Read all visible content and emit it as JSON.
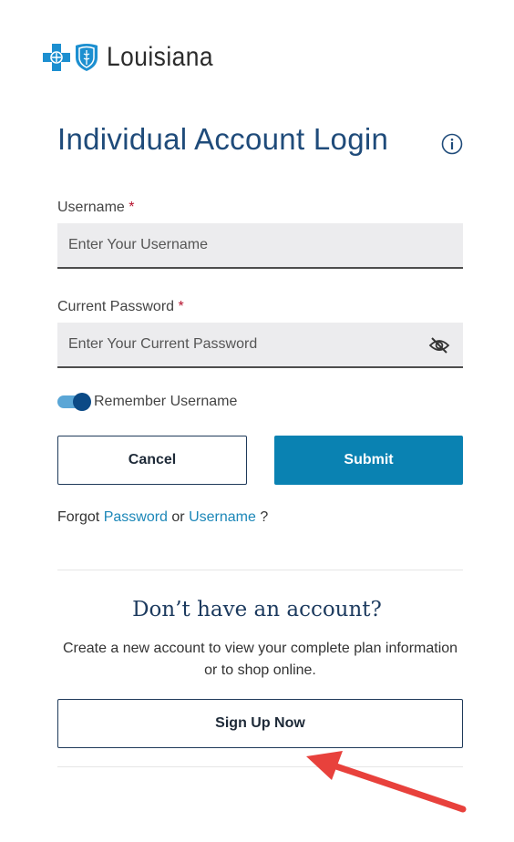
{
  "brand": {
    "name": "Louisiana",
    "blue": "#0a82b2",
    "navy": "#1f4b7a"
  },
  "login": {
    "title": "Individual Account Login",
    "username_label": "Username",
    "username_placeholder": "Enter Your Username",
    "password_label": "Current Password",
    "password_placeholder": "Enter Your Current Password",
    "required_marker": "*",
    "remember_label": "Remember Username",
    "remember_on": true,
    "cancel_label": "Cancel",
    "submit_label": "Submit",
    "forgot_prefix": "Forgot",
    "forgot_password": "Password",
    "forgot_or": "or",
    "forgot_username": "Username",
    "forgot_suffix": "?"
  },
  "signup": {
    "heading": "Don’t have an account?",
    "description": "Create a new account to view your complete plan information or to shop online.",
    "button_label": "Sign Up Now"
  },
  "annotation": {
    "arrow_color": "#e8413c"
  },
  "icons": {
    "logo_cross": "blue-cross-icon",
    "logo_shield": "blue-shield-icon",
    "info": "info-icon",
    "password_toggle": "eye-slash-icon"
  }
}
